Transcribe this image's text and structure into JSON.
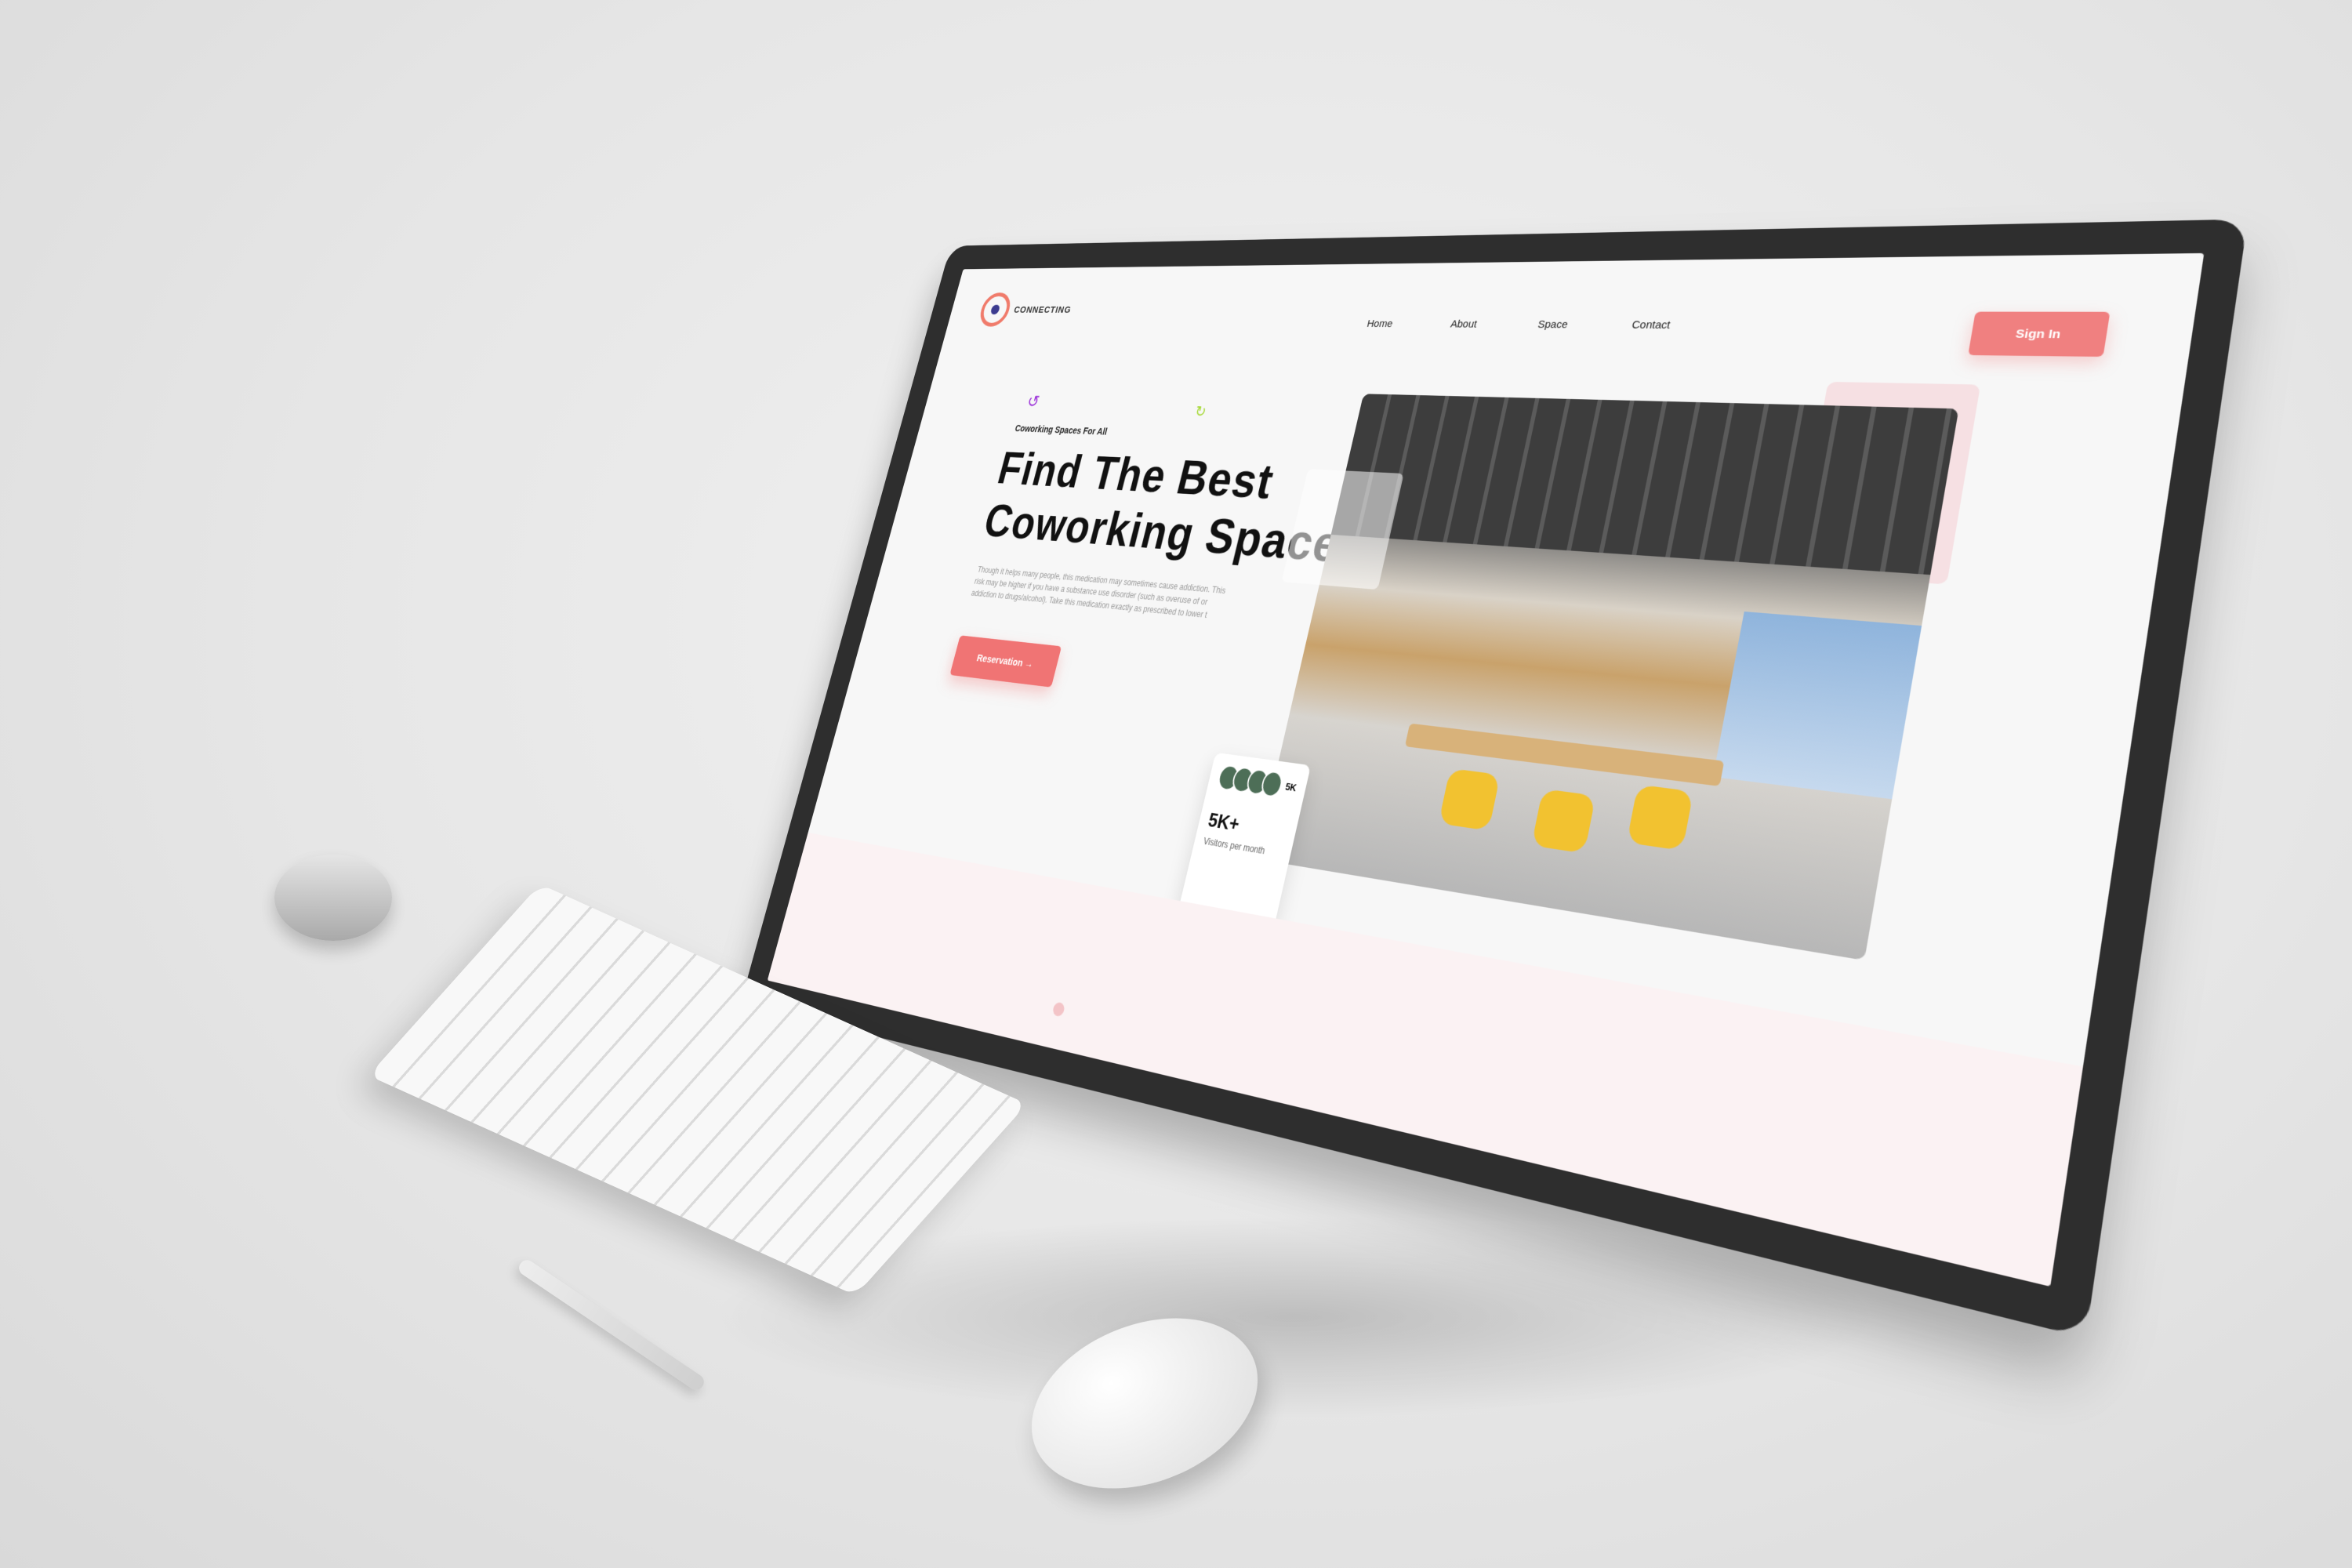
{
  "brand": {
    "logo_text": "CONNECTING",
    "accent_color": "#f07474"
  },
  "nav": {
    "items": [
      "Home",
      "About",
      "Space",
      "Contact"
    ],
    "signin_label": "Sign In"
  },
  "hero": {
    "eyebrow": "Coworking Spaces For All",
    "headline": "Find The Best Coworking Space",
    "paragraph": "Though it helps many people, this medication may sometimes cause addiction. This risk may be higher if you have a substance use disorder (such as overuse of or addiction to drugs/alcohol). Take this medication exactly as prescribed to lower t",
    "cta_label": "Reservation →"
  },
  "stats": {
    "avatar_count": "5K",
    "value": "5K+",
    "label": "Visitors per month"
  }
}
